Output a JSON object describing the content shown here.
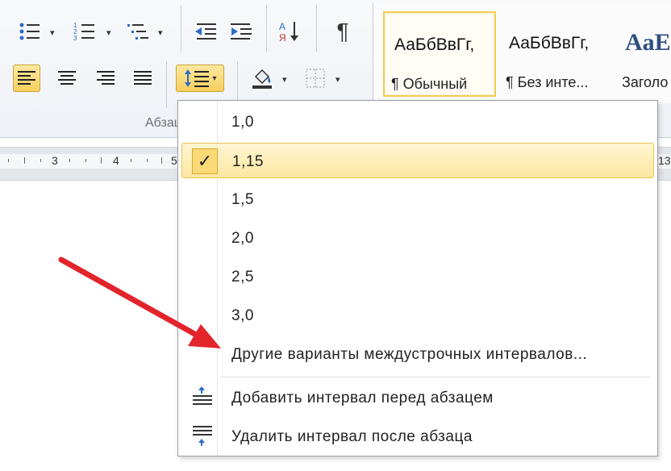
{
  "ribbon": {
    "group_label": "Абзац",
    "styles": [
      {
        "sample": "АаБбВвГг,",
        "name": "¶ Обычный"
      },
      {
        "sample": "АаБбВвГг,",
        "name": "¶ Без инте..."
      },
      {
        "sample": "AaE",
        "name": "Заголо"
      }
    ]
  },
  "ruler": {
    "numbers": [
      "3",
      "4",
      "5",
      "13"
    ]
  },
  "menu": {
    "items": [
      {
        "label": "1,0"
      },
      {
        "label": "1,15",
        "checked": true
      },
      {
        "label": "1,5"
      },
      {
        "label": "2,0"
      },
      {
        "label": "2,5"
      },
      {
        "label": "3,0"
      },
      {
        "label": "Другие варианты междустрочных интервалов..."
      },
      {
        "label": "Добавить интервал перед абзацем",
        "icon": "space-before-icon"
      },
      {
        "label": "Удалить интервал после абзаца",
        "icon": "space-after-icon"
      }
    ],
    "check_mark": "✓"
  },
  "colors": {
    "accent": "#f7cf5d",
    "arrow": "#e3242b"
  }
}
